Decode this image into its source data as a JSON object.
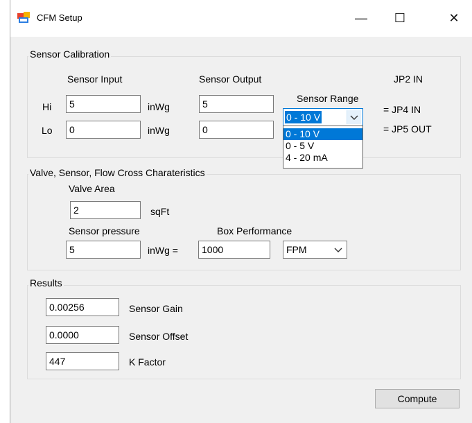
{
  "window": {
    "title": "CFM Setup",
    "minimize": "—",
    "maximize": "☐",
    "close": "✕"
  },
  "calibration": {
    "group_title": "Sensor Calibration",
    "sensor_input_label": "Sensor Input",
    "sensor_output_label": "Sensor Output",
    "sensor_range_label": "Sensor Range",
    "hi_label": "Hi",
    "lo_label": "Lo",
    "hi_input": "5",
    "lo_input": "0",
    "unit_hi": "inWg",
    "unit_lo": "inWg",
    "hi_output": "5",
    "lo_output": "0",
    "range_selected": "0 - 10 V",
    "range_options": [
      "0 - 10 V",
      "0 - 5 V",
      "4 - 20 mA"
    ],
    "jp2": "JP2 IN",
    "jp4": "= JP4 IN",
    "jp5": "= JP5 OUT"
  },
  "valve": {
    "group_title": "Valve, Sensor, Flow Cross Charateristics",
    "valve_area_label": "Valve Area",
    "valve_area": "2",
    "valve_area_unit": "sqFt",
    "sensor_pressure_label": "Sensor pressure",
    "sensor_pressure": "5",
    "pressure_unit": "inWg =",
    "box_performance_label": "Box Performance",
    "box_performance": "1000",
    "unit_selected": "FPM"
  },
  "results": {
    "group_title": "Results",
    "gain": "0.00256",
    "gain_label": "Sensor Gain",
    "offset": "0.0000",
    "offset_label": "Sensor Offset",
    "k": "447",
    "k_label": "K Factor"
  },
  "compute_label": "Compute",
  "colors": {
    "selection": "#0078d7",
    "window_bg": "#f0f0f0",
    "border": "#7a7a7a"
  }
}
